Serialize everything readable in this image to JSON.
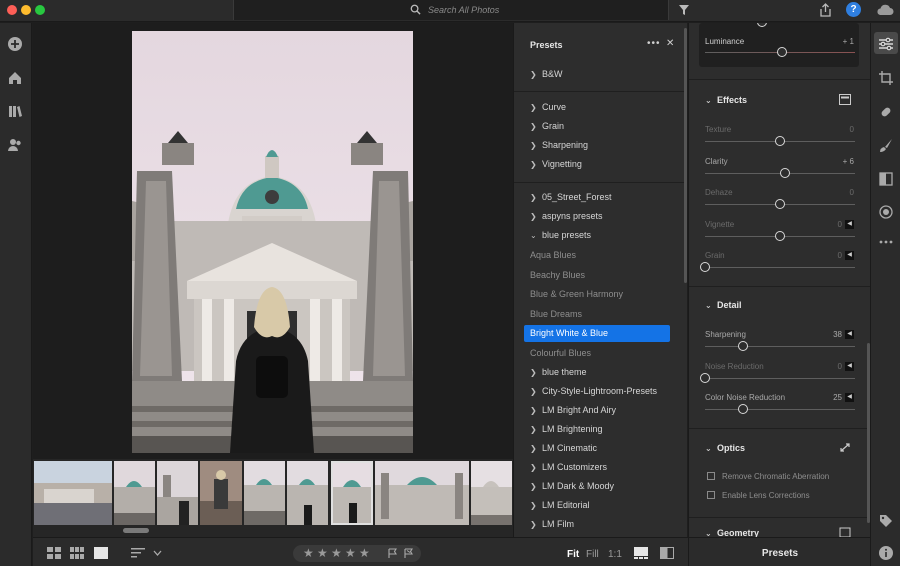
{
  "search": {
    "placeholder": "Search All Photos"
  },
  "help": {
    "label": "?"
  },
  "presets_panel": {
    "title": "Presets",
    "more": "•••",
    "close": "✕",
    "groups_top": [
      "B&W"
    ],
    "groups_mid": [
      "Curve",
      "Grain",
      "Sharpening",
      "Vignetting"
    ],
    "groups_user": [
      "05_Street_Forest",
      "aspyns presets",
      "blue presets"
    ],
    "blue_children": [
      "Aqua Blues",
      "Beachy Blues",
      "Blue & Green Harmony",
      "Blue Dreams"
    ],
    "selected": "Bright White & Blue",
    "blue_children_after": [
      "Colourful Blues"
    ],
    "groups_bottom": [
      "blue theme",
      "City-Style-Lightroom-Presets",
      "LM Bright And Airy",
      "LM Brightening",
      "LM Cinematic",
      "LM Customizers",
      "LM Dark & Moody",
      "LM Editorial",
      "LM Film"
    ]
  },
  "edit_panel": {
    "luminance": {
      "label": "Luminance",
      "value": "+ 1",
      "level": 0.51
    },
    "effects": {
      "title": "Effects",
      "sliders": [
        {
          "label": "Texture",
          "value": "0",
          "level": 0.5,
          "dim": true
        },
        {
          "label": "Clarity",
          "value": "+ 6",
          "level": 0.53,
          "dim": false
        },
        {
          "label": "Dehaze",
          "value": "0",
          "level": 0.5,
          "dim": true
        },
        {
          "label": "Vignette",
          "value": "0",
          "level": 0.5,
          "dim": true
        },
        {
          "label": "Grain",
          "value": "0",
          "level": 0.0,
          "dim": true
        }
      ]
    },
    "detail": {
      "title": "Detail",
      "sliders": [
        {
          "label": "Sharpening",
          "value": "38",
          "level": 0.25,
          "dim": false
        },
        {
          "label": "Noise Reduction",
          "value": "0",
          "level": 0.0,
          "dim": true
        },
        {
          "label": "Color Noise Reduction",
          "value": "25",
          "level": 0.25,
          "dim": false
        }
      ]
    },
    "optics": {
      "title": "Optics",
      "options": [
        "Remove Chromatic Aberration",
        "Enable Lens Corrections"
      ]
    },
    "geometry": {
      "title": "Geometry"
    },
    "presets_button": "Presets"
  },
  "bottom_bar": {
    "view_fit": "Fit",
    "view_fill": "Fill",
    "view_1to1": "1:1",
    "stars": [
      "★",
      "★",
      "★",
      "★",
      "★"
    ]
  }
}
